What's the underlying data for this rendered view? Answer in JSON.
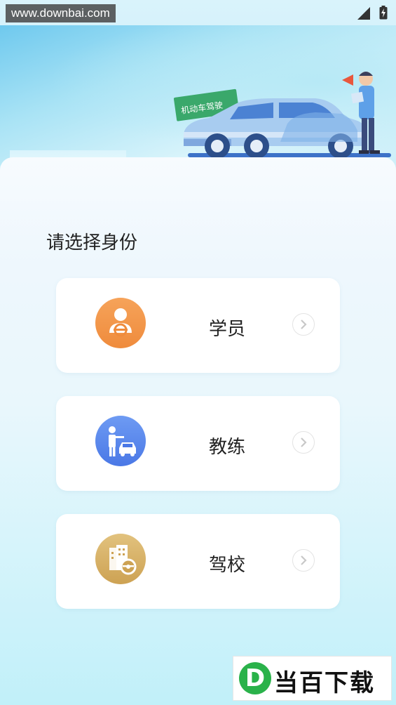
{
  "status_bar": {
    "watermark": "www.downbai.com",
    "signal_icon": "signal-icon",
    "battery_icon": "battery-icon"
  },
  "hero": {
    "sign_text": "机动车驾驶",
    "illustration": "car-and-instructor-illustration"
  },
  "page_title": "请选择身份",
  "roles": [
    {
      "label": "学员",
      "icon": "student-driver-icon",
      "color": "#ef8b3c"
    },
    {
      "label": "教练",
      "icon": "coach-with-car-icon",
      "color": "#4a78e6"
    },
    {
      "label": "驾校",
      "icon": "driving-school-building-icon",
      "color": "#cda253"
    }
  ],
  "brand": {
    "letter": "D",
    "name": "当百下载"
  }
}
